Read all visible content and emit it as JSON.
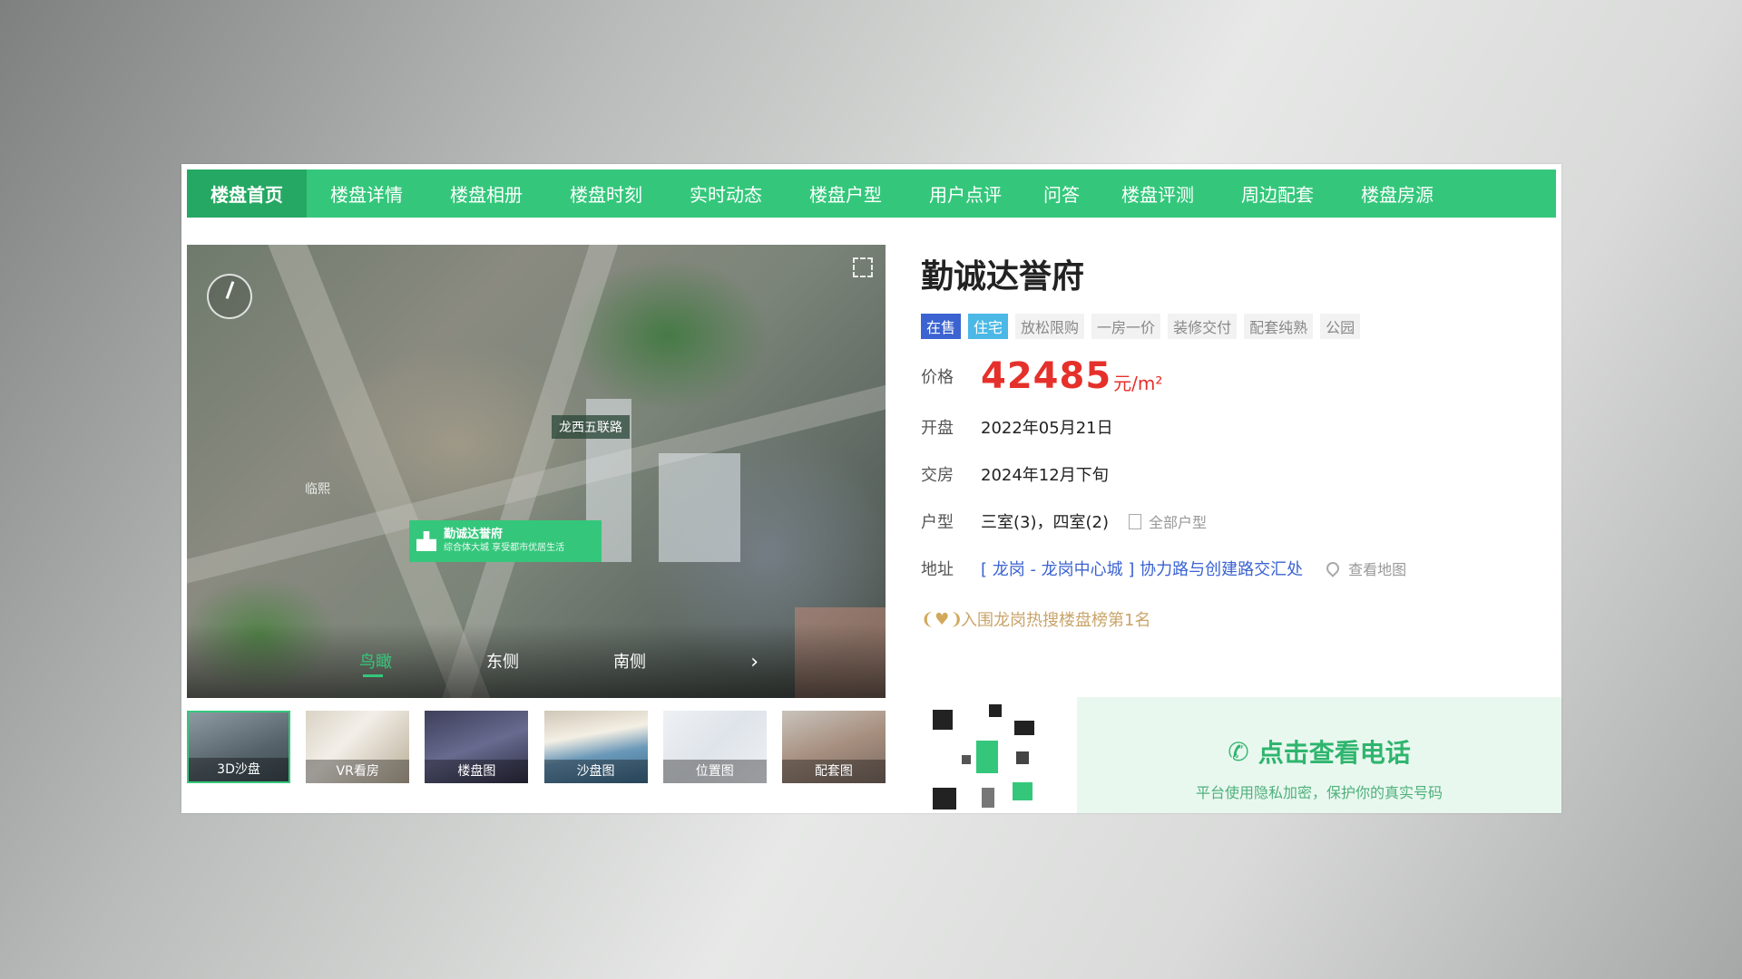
{
  "nav": {
    "items": [
      "楼盘首页",
      "楼盘详情",
      "楼盘相册",
      "楼盘时刻",
      "实时动态",
      "楼盘户型",
      "用户点评",
      "问答",
      "楼盘评测",
      "周边配套",
      "楼盘房源"
    ]
  },
  "gallery": {
    "map_labels": {
      "road": "龙西五联路",
      "area": "临熙"
    },
    "project_pin": {
      "title": "勤诚达誉府",
      "subtitle": "综合体大城 享受都市优居生活"
    },
    "view_tabs": [
      "鸟瞰",
      "东侧",
      "南侧"
    ],
    "thumbnails": [
      "3D沙盘",
      "VR看房",
      "楼盘图",
      "沙盘图",
      "位置图",
      "配套图"
    ]
  },
  "info": {
    "title": "勤诚达誉府",
    "tags": [
      "在售",
      "住宅",
      "放松限购",
      "一房一价",
      "装修交付",
      "配套纯熟",
      "公园"
    ],
    "price": {
      "label": "价格",
      "value": "42485",
      "unit": "元/m²"
    },
    "opening": {
      "label": "开盘",
      "value": "2022年05月21日"
    },
    "delivery": {
      "label": "交房",
      "value": "2024年12月下旬"
    },
    "layout": {
      "label": "户型",
      "value": "三室(3)，四室(2)",
      "link": "全部户型"
    },
    "address": {
      "label": "地址",
      "value": "[ 龙岗 - 龙岗中心城 ] 协力路与创建路交汇处",
      "link": "查看地图"
    },
    "rank": "入围龙岗热搜楼盘榜第1名"
  },
  "contact": {
    "button": "点击查看电话",
    "note": "平台使用隐私加密，保护你的真实号码"
  },
  "colors": {
    "brand": "#34c77b",
    "price": "#e5302b",
    "link": "#3b63d1"
  }
}
